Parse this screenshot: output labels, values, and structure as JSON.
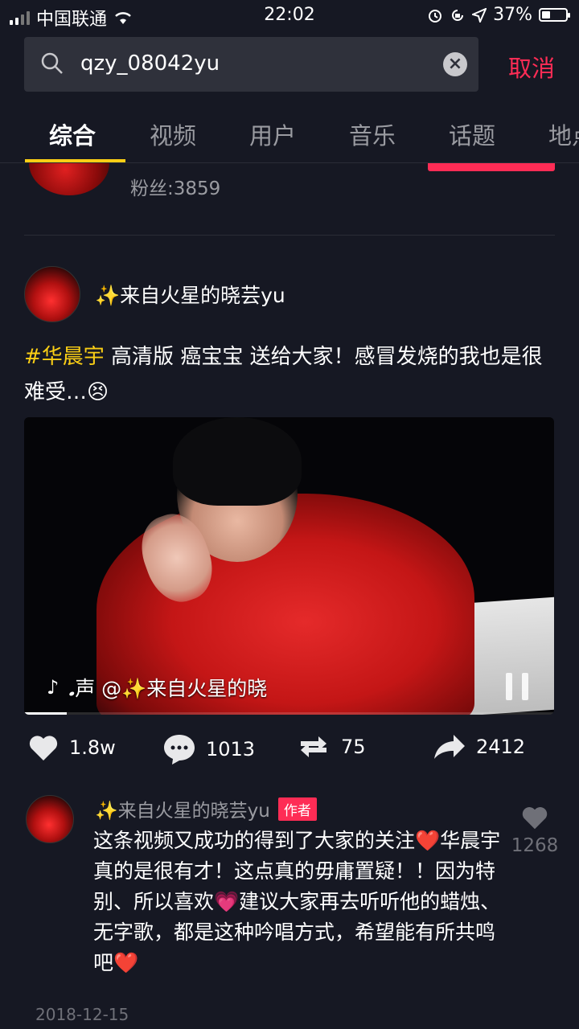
{
  "status": {
    "carrier": "中国联通",
    "time": "22:02",
    "battery": "37%",
    "battery_level": 0.37
  },
  "search": {
    "query": "qzy_08042yu",
    "cancel_label": "取消"
  },
  "tabs": [
    "综合",
    "视频",
    "用户",
    "音乐",
    "话题",
    "地点"
  ],
  "user_result": {
    "fans": "粉丝:3859"
  },
  "post": {
    "author": "✨来自火星的晓芸yu",
    "hashtag": "#华晨宇",
    "caption_text": " 高清版 癌宝宝 送给大家！感冒发烧的我也是很难受…😣",
    "video_overlay": "𝅘声  @✨来自火星的晓",
    "video_progress": 0.08,
    "stats": {
      "likes": "1.8w",
      "comments": "1013",
      "reposts": "75",
      "shares": "2412"
    }
  },
  "comment": {
    "author": "✨来自火星的晓芸yu",
    "badge": "作者",
    "text": "这条视频又成功的得到了大家的关注❤️华晨宇真的是很有才！这点真的毋庸置疑！！因为特别、所以喜欢💗建议大家再去听听他的蜡烛、无字歌，都是这种吟唱方式，希望能有所共鸣吧❤️",
    "likes": "1268"
  },
  "date": "2018-12-15"
}
